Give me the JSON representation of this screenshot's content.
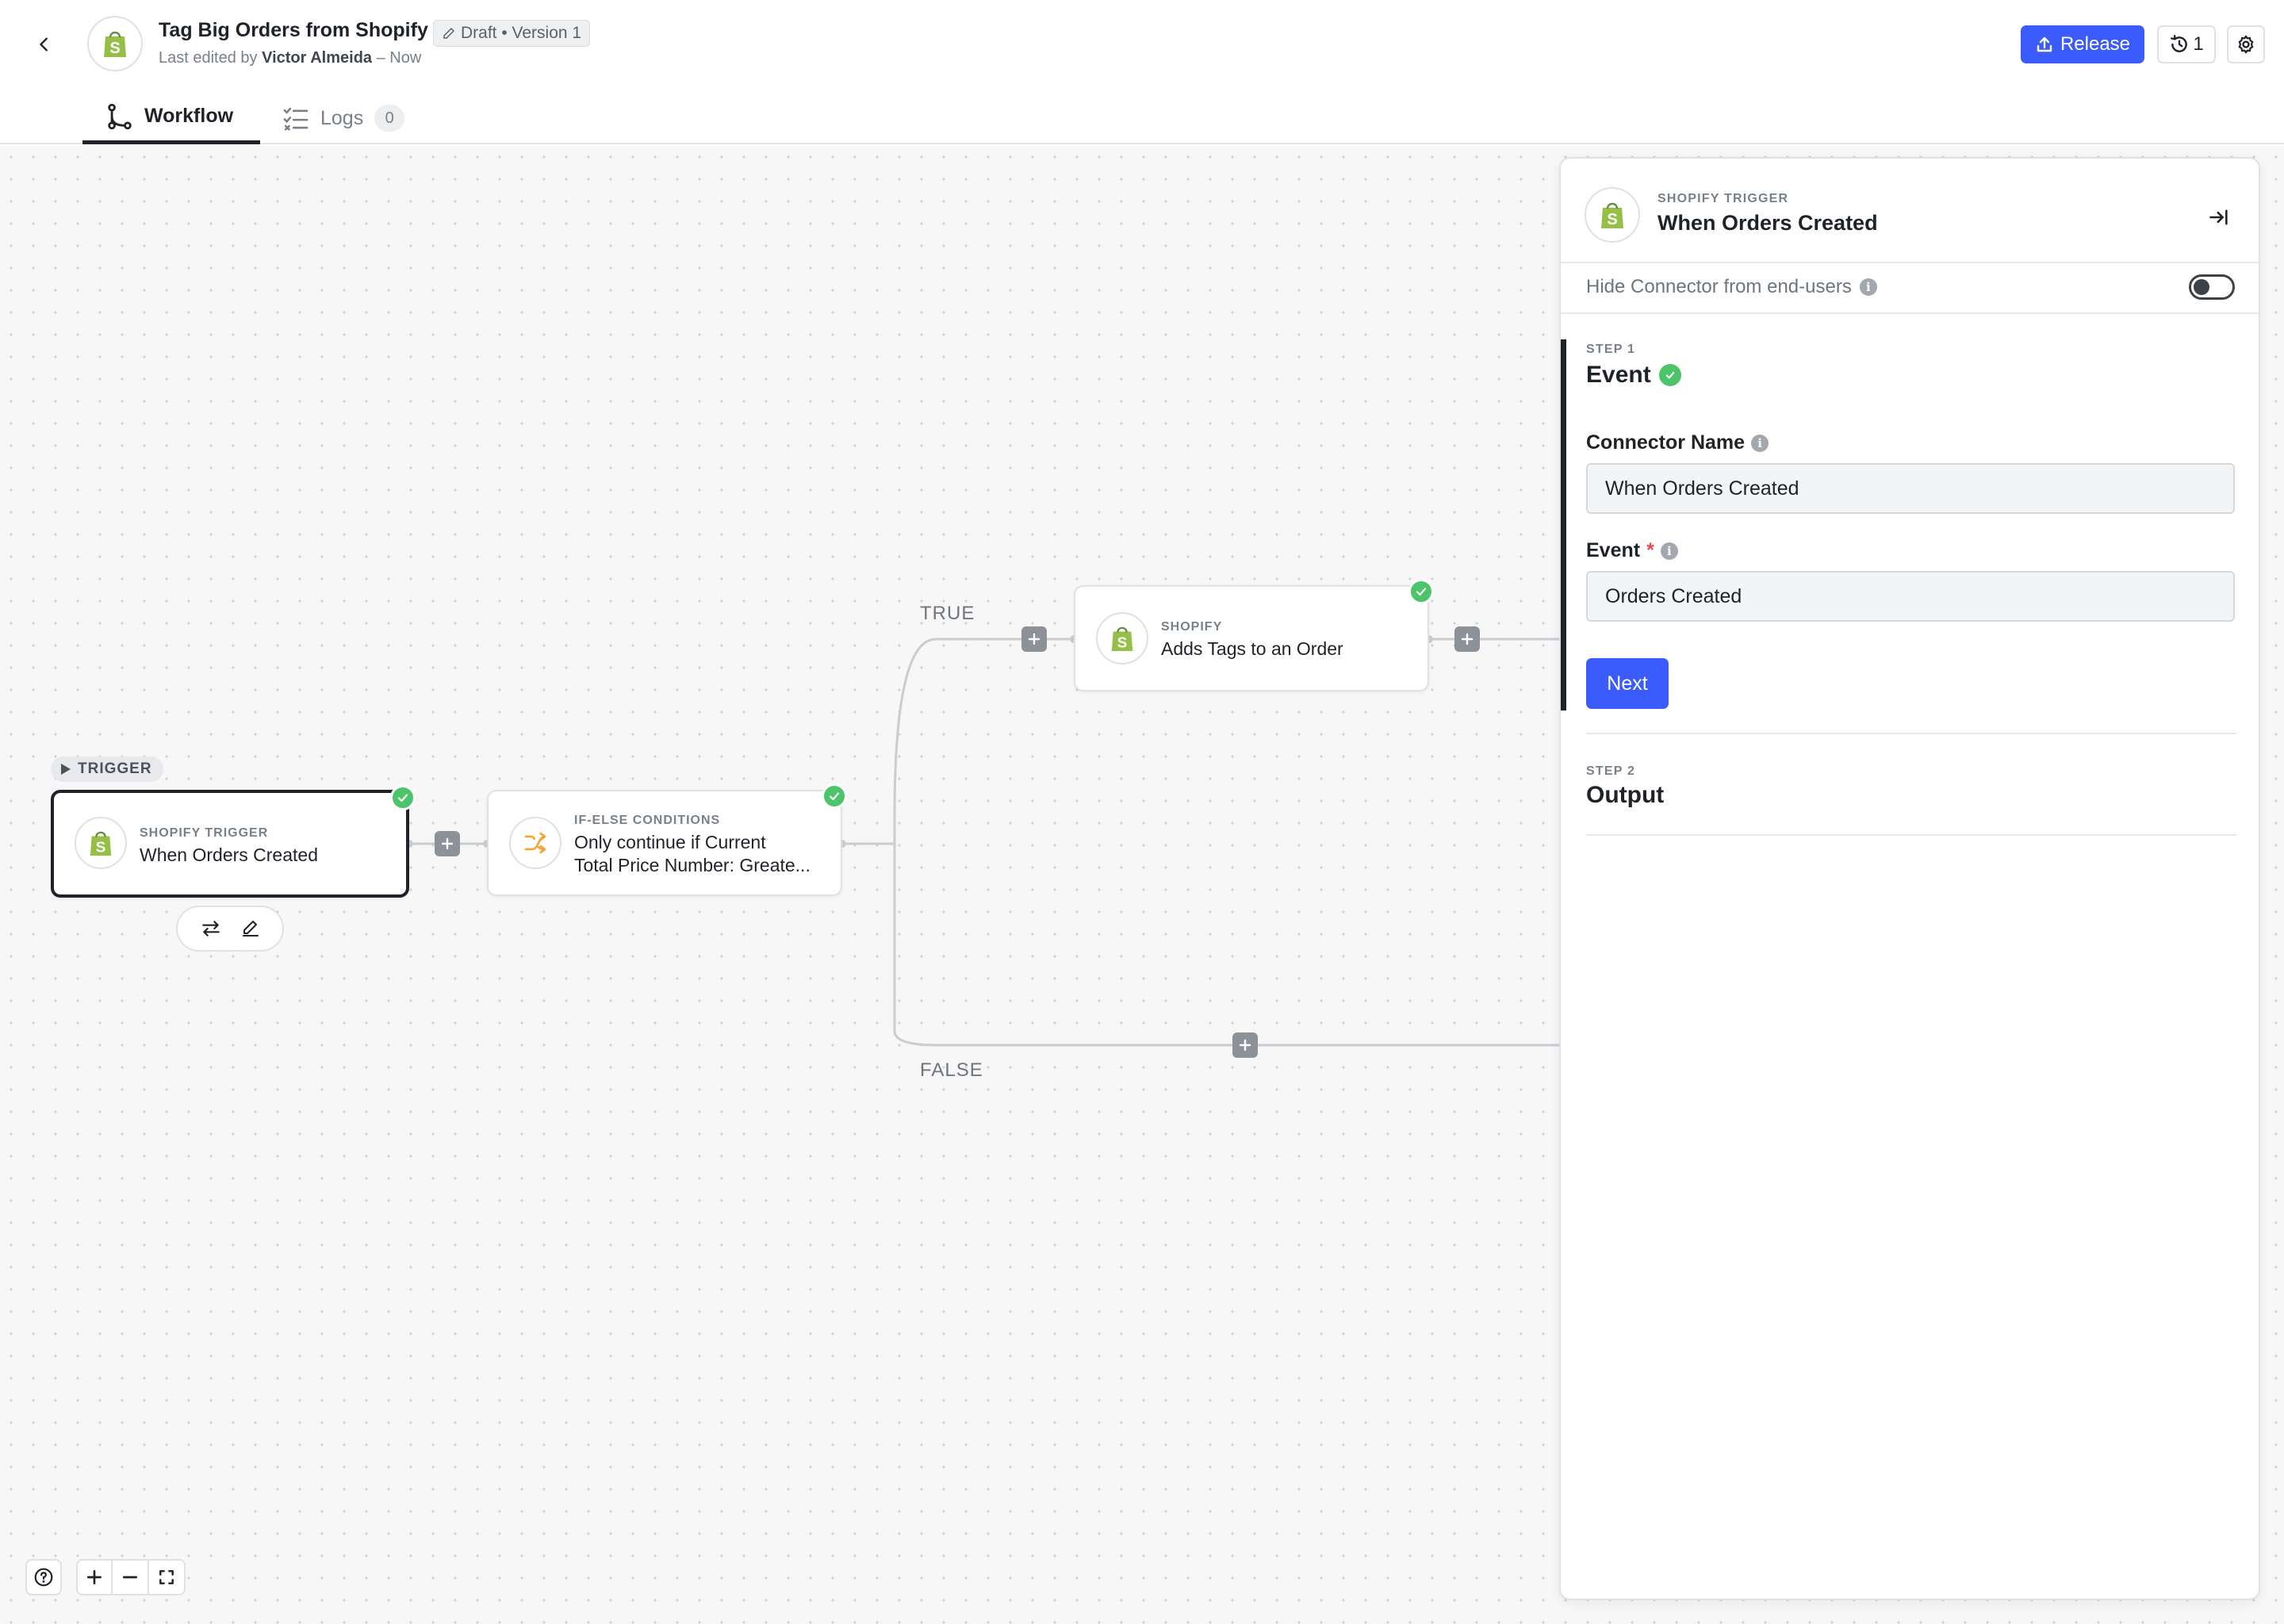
{
  "header": {
    "title": "Tag Big Orders from Shopify",
    "badge": "Draft • Version 1",
    "edited_prefix": "Last edited by",
    "edited_by": "Victor Almeida",
    "edited_when": "– Now",
    "release_label": "Release",
    "versions_count": "1"
  },
  "tabs": [
    {
      "label": "Workflow",
      "active": true
    },
    {
      "label": "Logs",
      "count": "0",
      "active": false
    }
  ],
  "canvas": {
    "trigger_tag": "TRIGGER",
    "branch_true": "TRUE",
    "branch_false": "FALSE",
    "nodes": [
      {
        "kicker": "SHOPIFY TRIGGER",
        "name": "When Orders Created",
        "icon": "shopify-icon",
        "status": "complete",
        "selected": true
      },
      {
        "kicker": "IF-ELSE CONDITIONS",
        "name_line1": "Only continue if Current",
        "name_line2": "Total Price Number: Greate...",
        "icon": "shuffle-icon",
        "status": "complete"
      },
      {
        "kicker": "SHOPIFY",
        "name": "Adds Tags to an Order",
        "icon": "shopify-icon",
        "status": "complete"
      }
    ]
  },
  "panel": {
    "kicker": "SHOPIFY TRIGGER",
    "title": "When Orders Created",
    "hide_label": "Hide Connector from end-users",
    "hide_enabled": false,
    "step1_kicker": "STEP 1",
    "step1_title": "Event",
    "connector_name_label": "Connector Name",
    "connector_name_value": "When Orders Created",
    "event_label": "Event",
    "event_value": "Orders Created",
    "next_label": "Next",
    "step2_kicker": "STEP 2",
    "step2_title": "Output"
  },
  "colors": {
    "accent": "#3b5bfd",
    "success": "#4cc46a",
    "shopify": "#95bf47"
  }
}
